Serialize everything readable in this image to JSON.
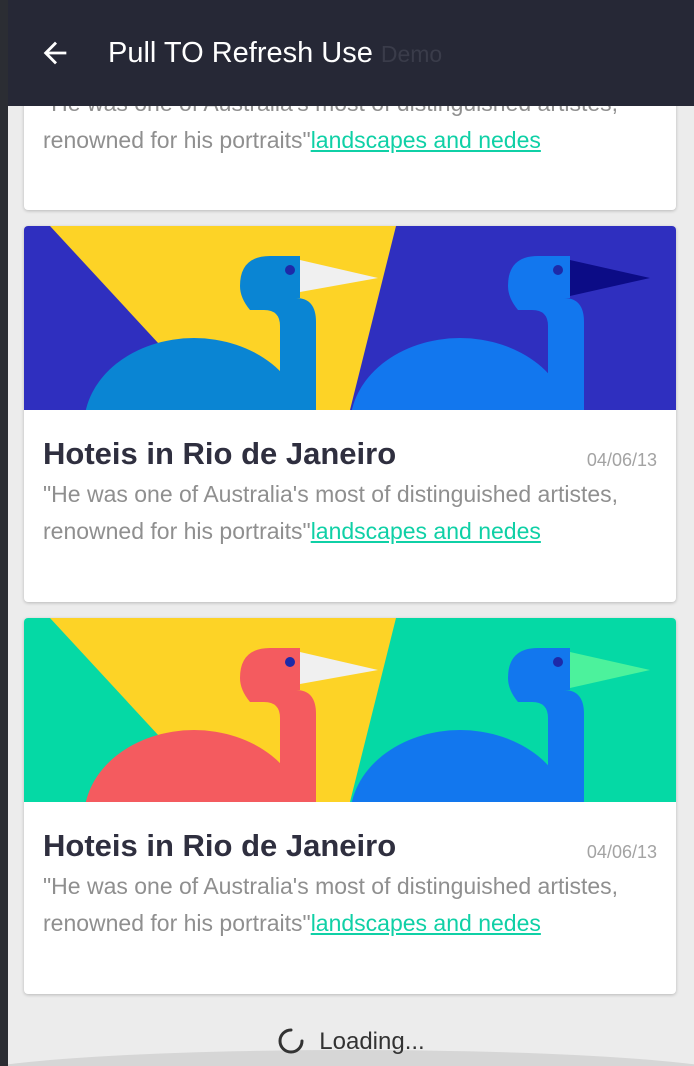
{
  "app_bar": {
    "back_icon": "arrow-left-icon",
    "title": "Pull TO Refresh Use",
    "title_faded": "Demo",
    "background": "#262836"
  },
  "cards": [
    {
      "partial": true,
      "description": "\"He was one of Australia's most of distinguished artistes, renowned for his portraits\"",
      "link": "landscapes and nedes"
    },
    {
      "title": "Hoteis in Rio de Janeiro",
      "date": "04/06/13",
      "description": "\"He was one of Australia's most of distinguished artistes, renowned for his portraits\"",
      "link": "landscapes and nedes",
      "image": {
        "theme": "blue-birds",
        "colors": [
          "#2f2fbf",
          "#fdd326",
          "#0a85d3",
          "#1277ee",
          "#f0f0f0",
          "#0c0c86"
        ]
      }
    },
    {
      "title": "Hoteis in Rio de Janeiro",
      "date": "04/06/13",
      "description": "\"He was one of Australia's most of distinguished artistes, renowned for his portraits\"",
      "link": "landscapes and nedes",
      "image": {
        "theme": "green-birds",
        "colors": [
          "#05d9a5",
          "#fdd326",
          "#f45b5f",
          "#1277ee",
          "#f0f0f0",
          "#4cf29c"
        ]
      }
    }
  ],
  "footer": {
    "loading_text": "Loading...",
    "spinner_icon": "loading-spinner-icon"
  },
  "colors": {
    "accent": "#0fd0a6",
    "title_text": "#2f2f3f",
    "body_text": "#8f8f8f",
    "screen_bg": "#ececec"
  }
}
